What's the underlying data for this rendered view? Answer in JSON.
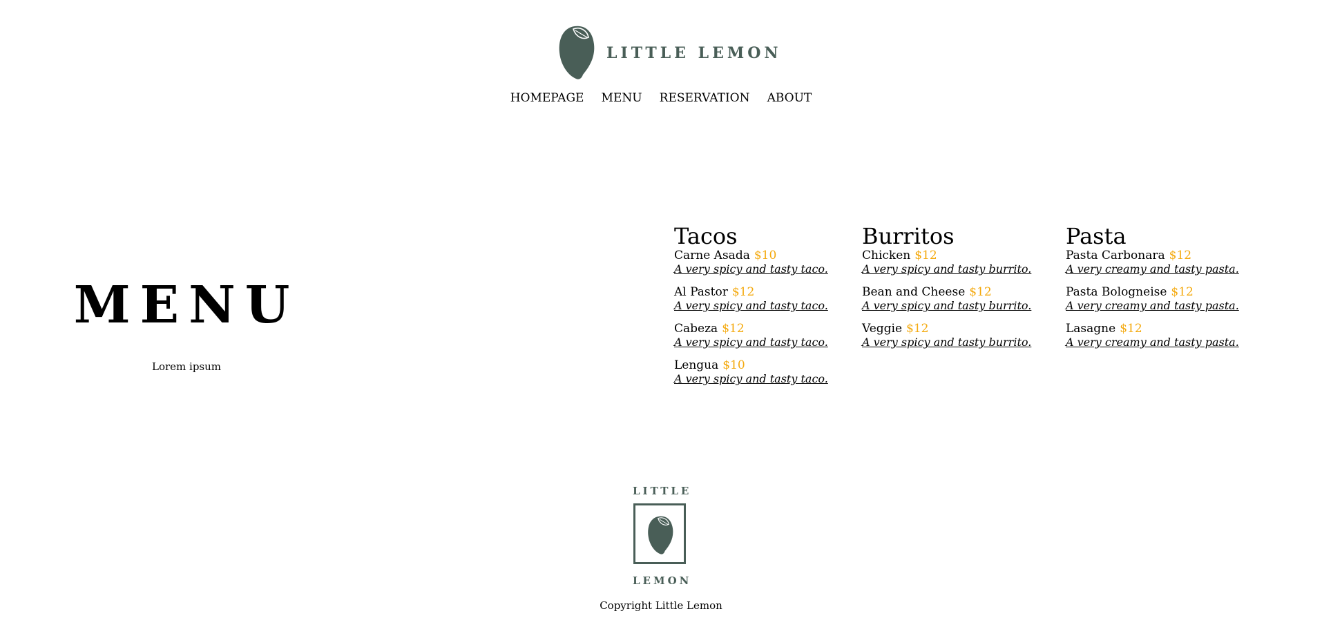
{
  "brand": {
    "name": "LITTLE LEMON",
    "logo_icon": "lemon-icon",
    "color": "#495e57"
  },
  "nav": [
    "HOMEPAGE",
    "MENU",
    "RESERVATION",
    "ABOUT"
  ],
  "hero": {
    "title": "MENU",
    "subtitle": "Lorem ipsum"
  },
  "price_color": "#f4a90d",
  "menu": [
    {
      "title": "Tacos",
      "items": [
        {
          "name": "Carne Asada",
          "price": "$10",
          "desc": "A very spicy and tasty taco."
        },
        {
          "name": "Al Pastor",
          "price": "$12",
          "desc": "A very spicy and tasty taco."
        },
        {
          "name": "Cabeza",
          "price": "$12",
          "desc": "A very spicy and tasty taco."
        },
        {
          "name": "Lengua",
          "price": "$10",
          "desc": "A very spicy and tasty taco."
        }
      ]
    },
    {
      "title": "Burritos",
      "items": [
        {
          "name": "Chicken",
          "price": "$12",
          "desc": "A very spicy and tasty burrito."
        },
        {
          "name": "Bean and Cheese",
          "price": "$12",
          "desc": "A very spicy and tasty burrito."
        },
        {
          "name": "Veggie",
          "price": "$12",
          "desc": "A very spicy and tasty burrito."
        }
      ]
    },
    {
      "title": "Pasta",
      "items": [
        {
          "name": "Pasta Carbonara",
          "price": "$12",
          "desc": "A very creamy and tasty pasta."
        },
        {
          "name": "Pasta Bologneise",
          "price": "$12",
          "desc": "A very creamy and tasty pasta."
        },
        {
          "name": "Lasagne",
          "price": "$12",
          "desc": "A very creamy and tasty pasta."
        }
      ]
    }
  ],
  "footer": {
    "logo_top": "LITTLE",
    "logo_bottom": "LEMON",
    "copyright": "Copyright Little Lemon"
  }
}
